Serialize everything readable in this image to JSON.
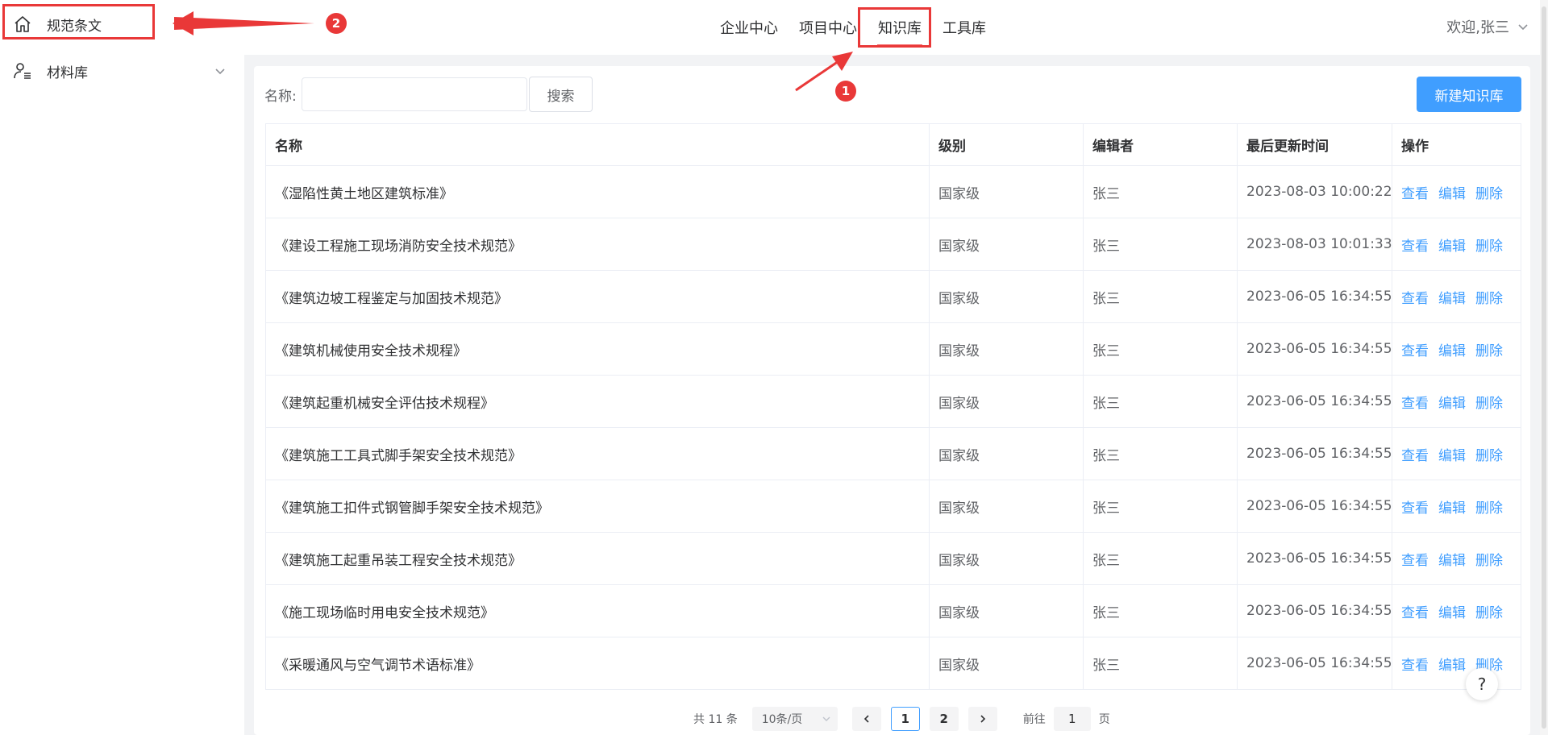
{
  "nav": {
    "items": [
      {
        "label": "企业中心"
      },
      {
        "label": "项目中心"
      },
      {
        "label": "知识库"
      },
      {
        "label": "工具库"
      }
    ],
    "active_index": 2
  },
  "user": {
    "greeting": "欢迎,张三"
  },
  "sidebar": {
    "items": [
      {
        "label": "规范条文",
        "icon": "home-icon"
      },
      {
        "label": "材料库",
        "icon": "user-list-icon"
      }
    ]
  },
  "search": {
    "label": "名称:",
    "placeholder": "",
    "value": "",
    "button_label": "搜索"
  },
  "toolbar": {
    "new_label": "新建知识库"
  },
  "table": {
    "columns": [
      "名称",
      "级别",
      "编辑者",
      "最后更新时间",
      "操作"
    ],
    "rows": [
      {
        "name": "《湿陷性黄土地区建筑标准》",
        "level": "国家级",
        "editor": "张三",
        "updated": "2023-08-03 10:00:22"
      },
      {
        "name": "《建设工程施工现场消防安全技术规范》",
        "level": "国家级",
        "editor": "张三",
        "updated": "2023-08-03 10:01:33"
      },
      {
        "name": "《建筑边坡工程鉴定与加固技术规范》",
        "level": "国家级",
        "editor": "张三",
        "updated": "2023-06-05 16:34:55"
      },
      {
        "name": "《建筑机械使用安全技术规程》",
        "level": "国家级",
        "editor": "张三",
        "updated": "2023-06-05 16:34:55"
      },
      {
        "name": "《建筑起重机械安全评估技术规程》",
        "level": "国家级",
        "editor": "张三",
        "updated": "2023-06-05 16:34:55"
      },
      {
        "name": "《建筑施工工具式脚手架安全技术规范》",
        "level": "国家级",
        "editor": "张三",
        "updated": "2023-06-05 16:34:55"
      },
      {
        "name": "《建筑施工扣件式钢管脚手架安全技术规范》",
        "level": "国家级",
        "editor": "张三",
        "updated": "2023-06-05 16:34:55"
      },
      {
        "name": "《建筑施工起重吊装工程安全技术规范》",
        "level": "国家级",
        "editor": "张三",
        "updated": "2023-06-05 16:34:55"
      },
      {
        "name": "《施工现场临时用电安全技术规范》",
        "level": "国家级",
        "editor": "张三",
        "updated": "2023-06-05 16:34:55"
      },
      {
        "name": "《采暖通风与空气调节术语标准》",
        "level": "国家级",
        "editor": "张三",
        "updated": "2023-06-05 16:34:55"
      }
    ],
    "actions": [
      "查看",
      "编辑",
      "删除"
    ]
  },
  "pagination": {
    "total_text": "共 11 条",
    "page_size_text": "10条/页",
    "pages": [
      "1",
      "2"
    ],
    "current_page": "1",
    "goto_label": "前往",
    "goto_value": "1",
    "page_suffix": "页"
  },
  "annotations": {
    "badges": [
      "1",
      "2"
    ],
    "color": "#e93838"
  },
  "help": {
    "label": "?"
  },
  "colors": {
    "primary": "#409eff",
    "annotation": "#e93838",
    "text": "#303133",
    "subtext": "#606266"
  }
}
